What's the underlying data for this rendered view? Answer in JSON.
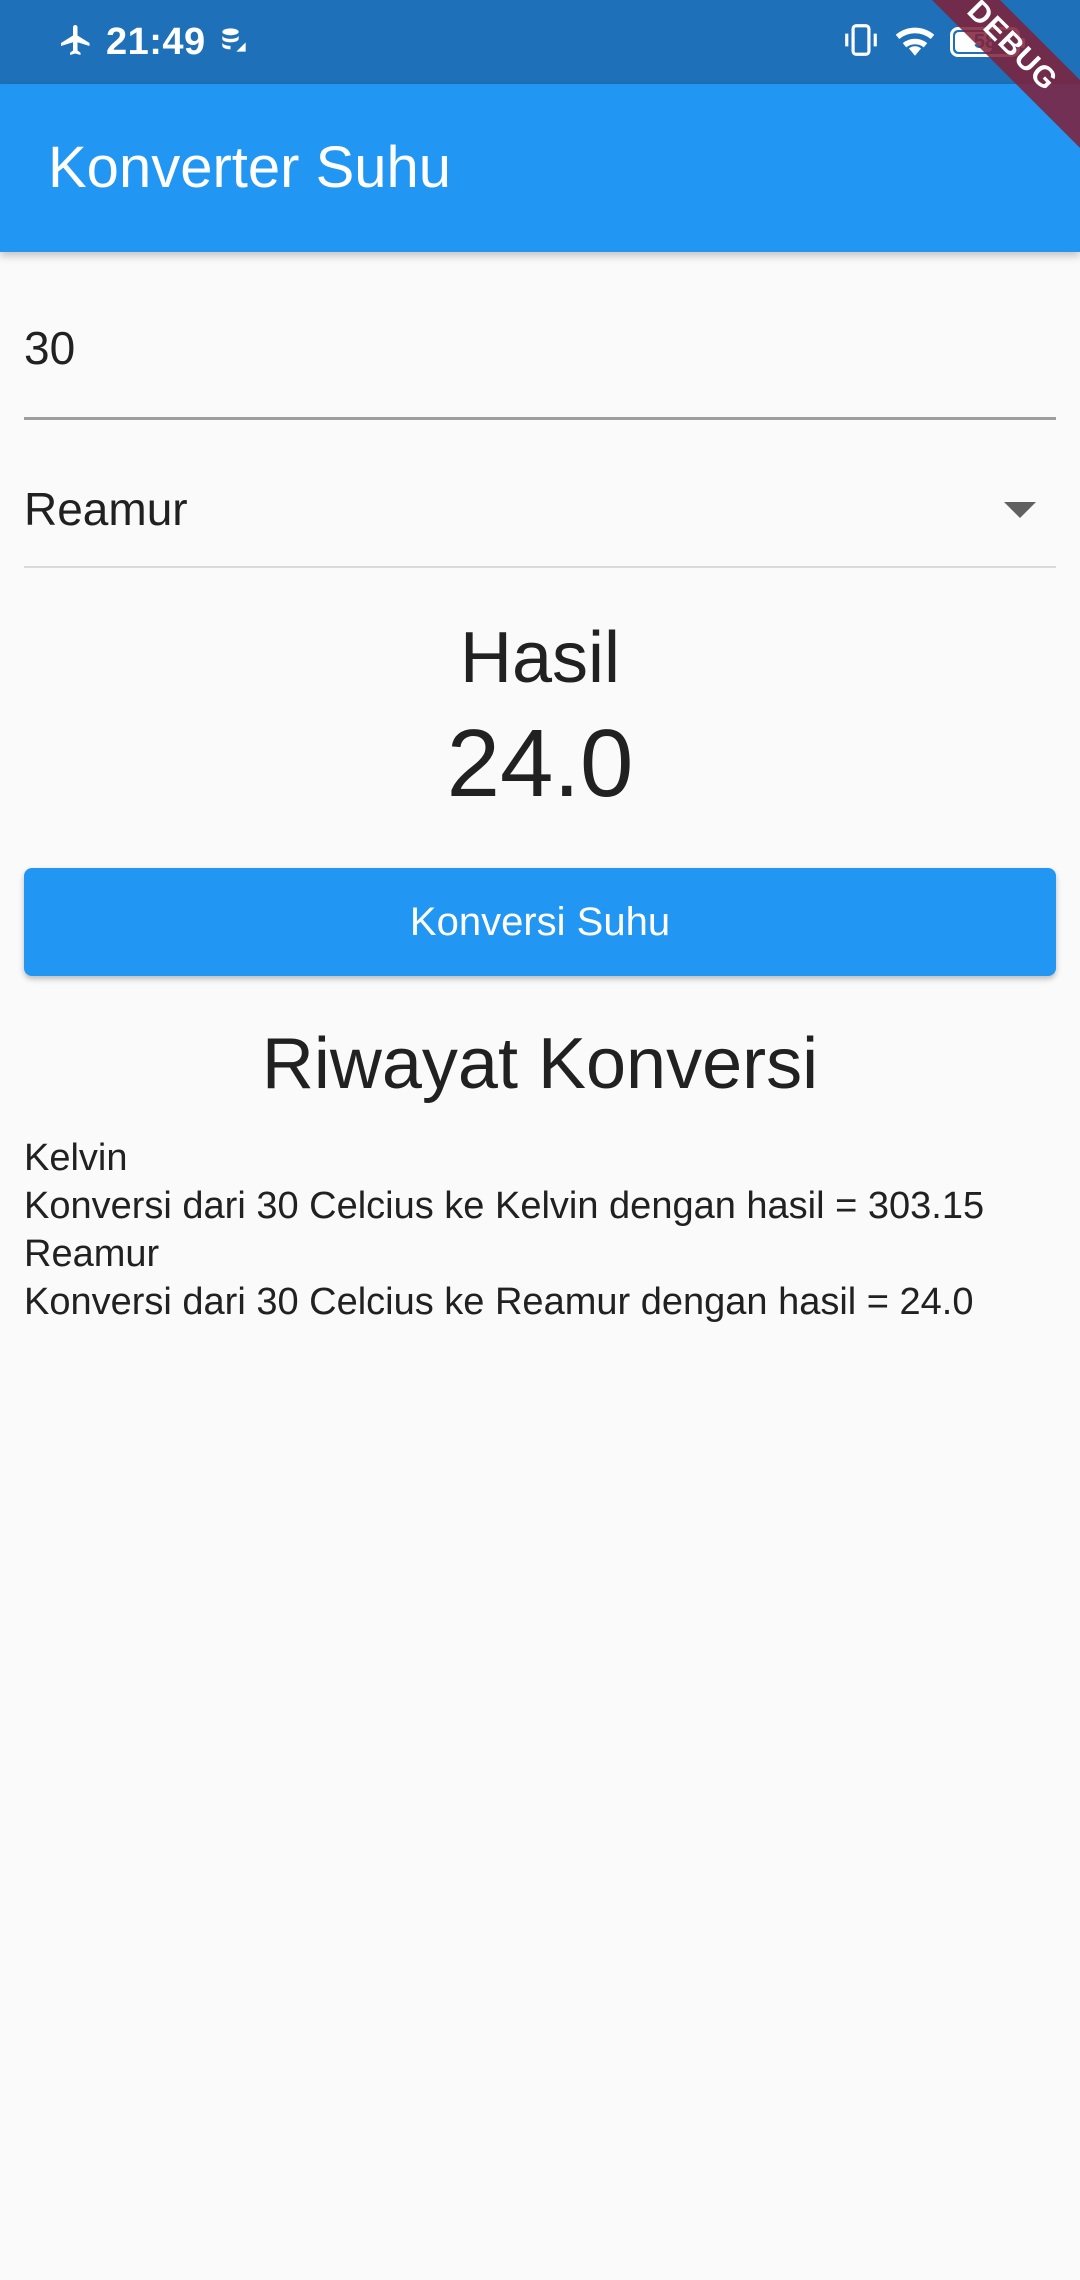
{
  "status_bar": {
    "time": "21:49",
    "battery_level": "58",
    "icons": [
      "airplane-mode-icon",
      "data-saver-icon",
      "vibrate-icon",
      "wifi-icon",
      "battery-icon"
    ]
  },
  "debug_banner": "DEBUG",
  "app_bar": {
    "title": "Konverter Suhu"
  },
  "input": {
    "value": "30"
  },
  "dropdown": {
    "selected": "Reamur"
  },
  "result": {
    "label": "Hasil",
    "value": "24.0"
  },
  "convert_button": {
    "label": "Konversi Suhu"
  },
  "history": {
    "title": "Riwayat Konversi",
    "items": [
      {
        "unit": "Kelvin",
        "text": "Konversi dari 30 Celcius ke Kelvin dengan hasil = 303.15"
      },
      {
        "unit": "Reamur",
        "text": "Konversi dari 30 Celcius ke Reamur dengan hasil = 24.0"
      }
    ]
  },
  "colors": {
    "status_bar": "#1e70b9",
    "app_bar": "#2196f3",
    "button": "#2196f3",
    "background": "#fafafa"
  }
}
